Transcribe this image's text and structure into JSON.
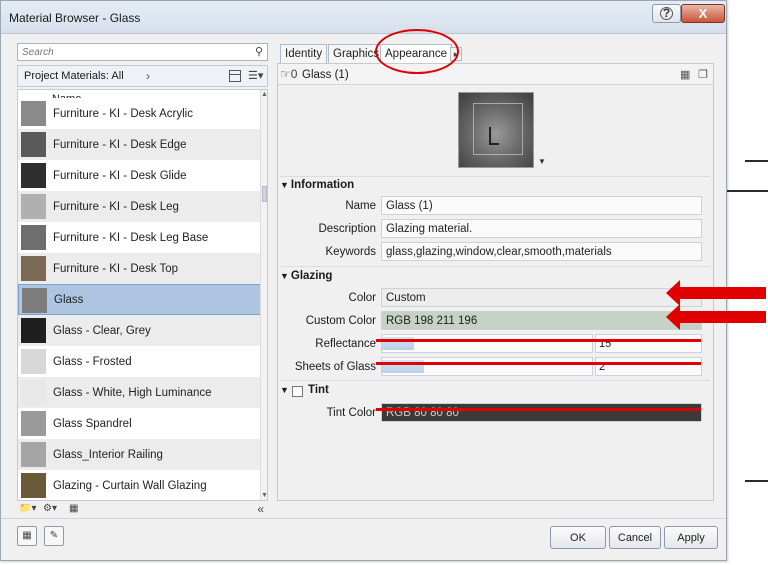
{
  "window": {
    "title": "Material Browser - Glass",
    "help_label": "?",
    "close_label": "X"
  },
  "search": {
    "placeholder": "Search"
  },
  "project_bar": {
    "label": "Project Materials: All"
  },
  "list": {
    "header": "Name",
    "items": [
      {
        "label": "Furniture - KI - Desk Acrylic",
        "thumb": "#8a8a8a"
      },
      {
        "label": "Furniture - KI - Desk Edge",
        "thumb": "#5a5a5a"
      },
      {
        "label": "Furniture - KI - Desk Glide",
        "thumb": "#2e2e2e"
      },
      {
        "label": "Furniture - KI - Desk Leg",
        "thumb": "#b0b0b0"
      },
      {
        "label": "Furniture - KI - Desk Leg Base",
        "thumb": "#6e6e6e"
      },
      {
        "label": "Furniture - KI - Desk Top",
        "thumb": "#7a6a55"
      },
      {
        "label": "Glass",
        "thumb": "#7c7c7c",
        "selected": true
      },
      {
        "label": "Glass - Clear, Grey",
        "thumb": "#1e1e1e"
      },
      {
        "label": "Glass - Frosted",
        "thumb": "#d8d8d8"
      },
      {
        "label": "Glass - White, High Luminance",
        "thumb": "#e8e8e8"
      },
      {
        "label": "Glass Spandrel",
        "thumb": "#9a9a9a"
      },
      {
        "label": "Glass_Interior Railing",
        "thumb": "#a5a5a5"
      },
      {
        "label": "Glazing - Curtain Wall Glazing",
        "thumb": "#6b5a3a"
      }
    ]
  },
  "tabs": [
    {
      "label": "Identity"
    },
    {
      "label": "Graphics"
    },
    {
      "label": "Appearance",
      "active": true
    }
  ],
  "material_header": {
    "count": "0",
    "name": "Glass (1)"
  },
  "information": {
    "title": "Information",
    "name_label": "Name",
    "name_value": "Glass (1)",
    "description_label": "Description",
    "description_value": "Glazing material.",
    "keywords_label": "Keywords",
    "keywords_value": "glass,glazing,window,clear,smooth,materials"
  },
  "glazing": {
    "title": "Glazing",
    "color_label": "Color",
    "color_value": "Custom",
    "custom_color_label": "Custom Color",
    "custom_color_value": "RGB 198 211 196",
    "reflectance_label": "Reflectance",
    "reflectance_value": "15",
    "reflectance_level": 0.15,
    "sheets_label": "Sheets of Glass",
    "sheets_value": "2",
    "sheets_level": 0.2
  },
  "tint": {
    "title": "Tint",
    "tint_color_label": "Tint Color",
    "tint_color_value": "RGB 80 80 80"
  },
  "buttons": {
    "ok": "OK",
    "cancel": "Cancel",
    "apply": "Apply"
  },
  "colors": {
    "selection": "#aec5e2",
    "annotation": "#e00000",
    "custom_swatch": "#c6d3c4",
    "tint_swatch": "#3a3a3a"
  }
}
